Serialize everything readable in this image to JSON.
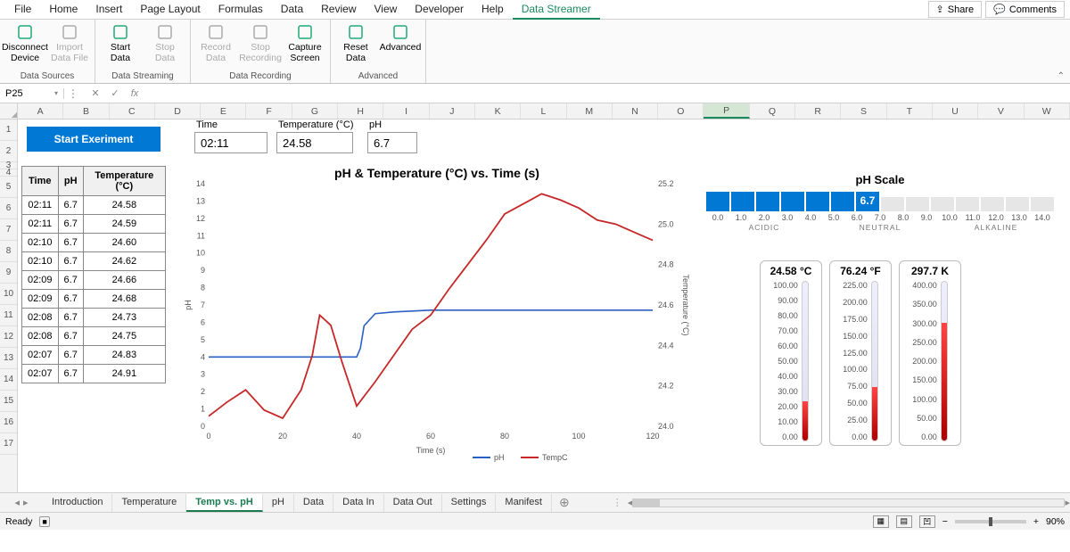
{
  "menu": {
    "items": [
      "File",
      "Home",
      "Insert",
      "Page Layout",
      "Formulas",
      "Data",
      "Review",
      "View",
      "Developer",
      "Help",
      "Data Streamer"
    ],
    "active_index": 10,
    "share": "Share",
    "comments": "Comments"
  },
  "ribbon": {
    "groups": [
      {
        "label": "Data Sources",
        "buttons": [
          {
            "id": "disconnect",
            "l1": "Disconnect",
            "l2": "Device",
            "dim": false,
            "color": "#2a7"
          },
          {
            "id": "import",
            "l1": "Import",
            "l2": "Data File",
            "dim": true,
            "color": "#aaa"
          }
        ]
      },
      {
        "label": "Data Streaming",
        "buttons": [
          {
            "id": "start",
            "l1": "Start",
            "l2": "Data",
            "dim": false,
            "color": "#2a7"
          },
          {
            "id": "stop",
            "l1": "Stop",
            "l2": "Data",
            "dim": true,
            "color": "#aaa"
          }
        ]
      },
      {
        "label": "Data Recording",
        "buttons": [
          {
            "id": "record",
            "l1": "Record",
            "l2": "Data",
            "dim": true,
            "color": "#aaa"
          },
          {
            "id": "stoprec",
            "l1": "Stop",
            "l2": "Recording",
            "dim": true,
            "color": "#aaa"
          },
          {
            "id": "capture",
            "l1": "Capture",
            "l2": "Screen",
            "dim": false,
            "color": "#2a7"
          }
        ]
      },
      {
        "label": "Advanced",
        "buttons": [
          {
            "id": "reset",
            "l1": "Reset",
            "l2": "Data",
            "dim": false,
            "color": "#2a7"
          },
          {
            "id": "advanced",
            "l1": "Advanced",
            "l2": "",
            "dim": false,
            "color": "#2a7"
          }
        ]
      }
    ]
  },
  "namebox": "P25",
  "columns": [
    "A",
    "B",
    "C",
    "D",
    "E",
    "F",
    "G",
    "H",
    "I",
    "J",
    "K",
    "L",
    "M",
    "N",
    "O",
    "P",
    "Q",
    "R",
    "S",
    "T",
    "U",
    "V",
    "W"
  ],
  "selected_col_index": 15,
  "rows": [
    "1",
    "2",
    "3",
    "4",
    "5",
    "6",
    "7",
    "8",
    "9",
    "10",
    "11",
    "12",
    "13",
    "14",
    "15",
    "16",
    "17"
  ],
  "start_button": "Start Exeriment",
  "top_vals": {
    "time_label": "Time",
    "time": "02:11",
    "temp_label": "Temperature (°C)",
    "temp": "24.58",
    "ph_label": "pH",
    "ph": "6.7"
  },
  "table": {
    "headers": [
      "Time",
      "pH",
      "Temperature (°C)"
    ],
    "rows": [
      [
        "02:11",
        "6.7",
        "24.58"
      ],
      [
        "02:11",
        "6.7",
        "24.59"
      ],
      [
        "02:10",
        "6.7",
        "24.60"
      ],
      [
        "02:10",
        "6.7",
        "24.62"
      ],
      [
        "02:09",
        "6.7",
        "24.66"
      ],
      [
        "02:09",
        "6.7",
        "24.68"
      ],
      [
        "02:08",
        "6.7",
        "24.73"
      ],
      [
        "02:08",
        "6.7",
        "24.75"
      ],
      [
        "02:07",
        "6.7",
        "24.83"
      ],
      [
        "02:07",
        "6.7",
        "24.91"
      ]
    ]
  },
  "chart_title": "pH & Temperature (°C) vs. Time (s)",
  "chart_data": {
    "type": "line",
    "title": "pH & Temperature (°C) vs. Time (s)",
    "xlabel": "Time (s)",
    "ylabel": "pH",
    "y2label": "Temperature (°C)",
    "xlim": [
      0,
      120
    ],
    "ylim_left": [
      0,
      14
    ],
    "ylim_right": [
      24.0,
      25.2
    ],
    "legend": [
      "pH",
      "TempC"
    ],
    "series": [
      {
        "name": "pH",
        "color": "#2a5fc4",
        "axis": "left",
        "x": [
          0,
          10,
          20,
          25,
          30,
          35,
          40,
          41,
          42,
          45,
          50,
          60,
          80,
          100,
          120
        ],
        "y": [
          4.0,
          4.0,
          4.0,
          4.0,
          4.0,
          4.0,
          4.0,
          4.5,
          5.8,
          6.5,
          6.6,
          6.7,
          6.7,
          6.7,
          6.7
        ]
      },
      {
        "name": "TempC",
        "color": "#c62828",
        "axis": "right",
        "x": [
          0,
          5,
          10,
          15,
          20,
          25,
          28,
          30,
          33,
          36,
          40,
          45,
          50,
          55,
          60,
          65,
          70,
          75,
          80,
          85,
          90,
          95,
          100,
          105,
          110,
          115,
          120
        ],
        "y": [
          24.05,
          24.12,
          24.18,
          24.08,
          24.04,
          24.18,
          24.35,
          24.55,
          24.5,
          24.32,
          24.1,
          24.22,
          24.35,
          24.48,
          24.55,
          24.68,
          24.8,
          24.92,
          25.05,
          25.1,
          25.15,
          25.12,
          25.08,
          25.02,
          25.0,
          24.96,
          24.92
        ]
      }
    ],
    "x_ticks": [
      0,
      20,
      40,
      60,
      80,
      100,
      120
    ],
    "y_left_ticks": [
      0,
      1,
      2,
      3,
      4,
      5,
      6,
      7,
      8,
      9,
      10,
      11,
      12,
      13,
      14
    ],
    "y_right_ticks": [
      24.0,
      24.2,
      24.4,
      24.6,
      24.8,
      25.0,
      25.2
    ]
  },
  "ph_scale": {
    "title": "pH Scale",
    "value": "6.7",
    "ticks": [
      "0.0",
      "1.0",
      "2.0",
      "3.0",
      "4.0",
      "5.0",
      "6.0",
      "7.0",
      "8.0",
      "9.0",
      "10.0",
      "11.0",
      "12.0",
      "13.0",
      "14.0"
    ],
    "zones": [
      "ACIDIC",
      "NEUTRAL",
      "ALKALINE"
    ]
  },
  "thermos": [
    {
      "title": "24.58 °C",
      "ticks": [
        "100.00",
        "90.00",
        "80.00",
        "70.00",
        "60.00",
        "50.00",
        "40.00",
        "30.00",
        "20.00",
        "10.00",
        "0.00"
      ],
      "fill_pct": 24.6
    },
    {
      "title": "76.24 °F",
      "ticks": [
        "225.00",
        "200.00",
        "175.00",
        "150.00",
        "125.00",
        "100.00",
        "75.00",
        "50.00",
        "25.00",
        "0.00"
      ],
      "fill_pct": 33.9
    },
    {
      "title": "297.7 K",
      "ticks": [
        "400.00",
        "350.00",
        "300.00",
        "250.00",
        "200.00",
        "150.00",
        "100.00",
        "50.00",
        "0.00"
      ],
      "fill_pct": 74.4
    }
  ],
  "sheets": {
    "tabs": [
      "Introduction",
      "Temperature",
      "Temp vs. pH",
      "pH",
      "Data",
      "Data In",
      "Data Out",
      "Settings",
      "Manifest"
    ],
    "active_index": 2
  },
  "status": {
    "ready": "Ready",
    "zoom": "90%"
  }
}
